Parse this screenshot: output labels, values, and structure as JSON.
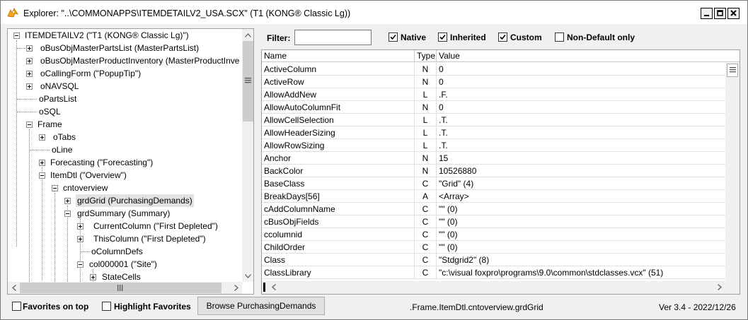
{
  "window": {
    "title": "Explorer: \"..\\COMMONAPPS\\ITEMDETAILV2_USA.SCX\" (T1 (KONG® Classic Lg))"
  },
  "tree": {
    "nodes": [
      {
        "label": "ITEMDETAILV2 (\"T1 (KONG® Classic Lg)\")"
      },
      {
        "label": "oBusObjMasterPartsList (MasterPartsList)"
      },
      {
        "label": "oBusObjMasterProductInventory (MasterProductInve"
      },
      {
        "label": "oCallingForm (\"PopupTip\")"
      },
      {
        "label": "oNAVSQL"
      },
      {
        "label": "oPartsList"
      },
      {
        "label": "oSQL"
      },
      {
        "label": "Frame"
      },
      {
        "label": "oTabs"
      },
      {
        "label": "oLine"
      },
      {
        "label": "Forecasting (\"Forecasting\")"
      },
      {
        "label": "ItemDtl (\"Overview\")"
      },
      {
        "label": "cntoverview"
      },
      {
        "label": "grdGrid (PurchasingDemands)"
      },
      {
        "label": "grdSummary (Summary)"
      },
      {
        "label": "CurrentColumn (\"First Depleted\")"
      },
      {
        "label": "ThisColumn (\"First Depleted\")"
      },
      {
        "label": "oColumnDefs"
      },
      {
        "label": "col000001 (\"Site\")"
      },
      {
        "label": "StateCells"
      }
    ]
  },
  "filter": {
    "label": "Filter:",
    "value": ""
  },
  "checkboxes": [
    {
      "label": "Native",
      "checked": true
    },
    {
      "label": "Inherited",
      "checked": true
    },
    {
      "label": "Custom",
      "checked": true
    },
    {
      "label": "Non-Default only",
      "checked": false
    }
  ],
  "grid": {
    "columns": [
      "Name",
      "Type",
      "Value"
    ],
    "rows": [
      {
        "name": "ActiveColumn",
        "type": "N",
        "value": "0"
      },
      {
        "name": "ActiveRow",
        "type": "N",
        "value": "0"
      },
      {
        "name": "AllowAddNew",
        "type": "L",
        "value": ".F."
      },
      {
        "name": "AllowAutoColumnFit",
        "type": "N",
        "value": "0"
      },
      {
        "name": "AllowCellSelection",
        "type": "L",
        "value": ".T."
      },
      {
        "name": "AllowHeaderSizing",
        "type": "L",
        "value": ".T."
      },
      {
        "name": "AllowRowSizing",
        "type": "L",
        "value": ".T."
      },
      {
        "name": "Anchor",
        "type": "N",
        "value": "15"
      },
      {
        "name": "BackColor",
        "type": "N",
        "value": "10526880"
      },
      {
        "name": "BaseClass",
        "type": "C",
        "value": "\"Grid\"  (4)"
      },
      {
        "name": "BreakDays[56]",
        "type": "A",
        "value": "<Array>"
      },
      {
        "name": "cAddColumnName",
        "type": "C",
        "value": "\"\"  (0)"
      },
      {
        "name": "cBusObjFields",
        "type": "C",
        "value": "\"\"  (0)"
      },
      {
        "name": "ccolumnid",
        "type": "C",
        "value": "\"\"  (0)"
      },
      {
        "name": "ChildOrder",
        "type": "C",
        "value": "\"\"  (0)"
      },
      {
        "name": "Class",
        "type": "C",
        "value": "\"Stdgrid2\"  (8)"
      },
      {
        "name": "ClassLibrary",
        "type": "C",
        "value": "\"c:\\visual foxpro\\programs\\9.0\\common\\stdclasses.vcx\"  (51)"
      }
    ]
  },
  "bottom": {
    "favorites_on_top": {
      "label": "Favorites on top",
      "checked": false
    },
    "highlight_favorites": {
      "label": "Highlight Favorites",
      "checked": false
    },
    "browse_button": "Browse PurchasingDemands",
    "status_path": ".Frame.ItemDtl.cntoverview.grdGrid",
    "version": "Ver 3.4 - 2022/12/26"
  }
}
